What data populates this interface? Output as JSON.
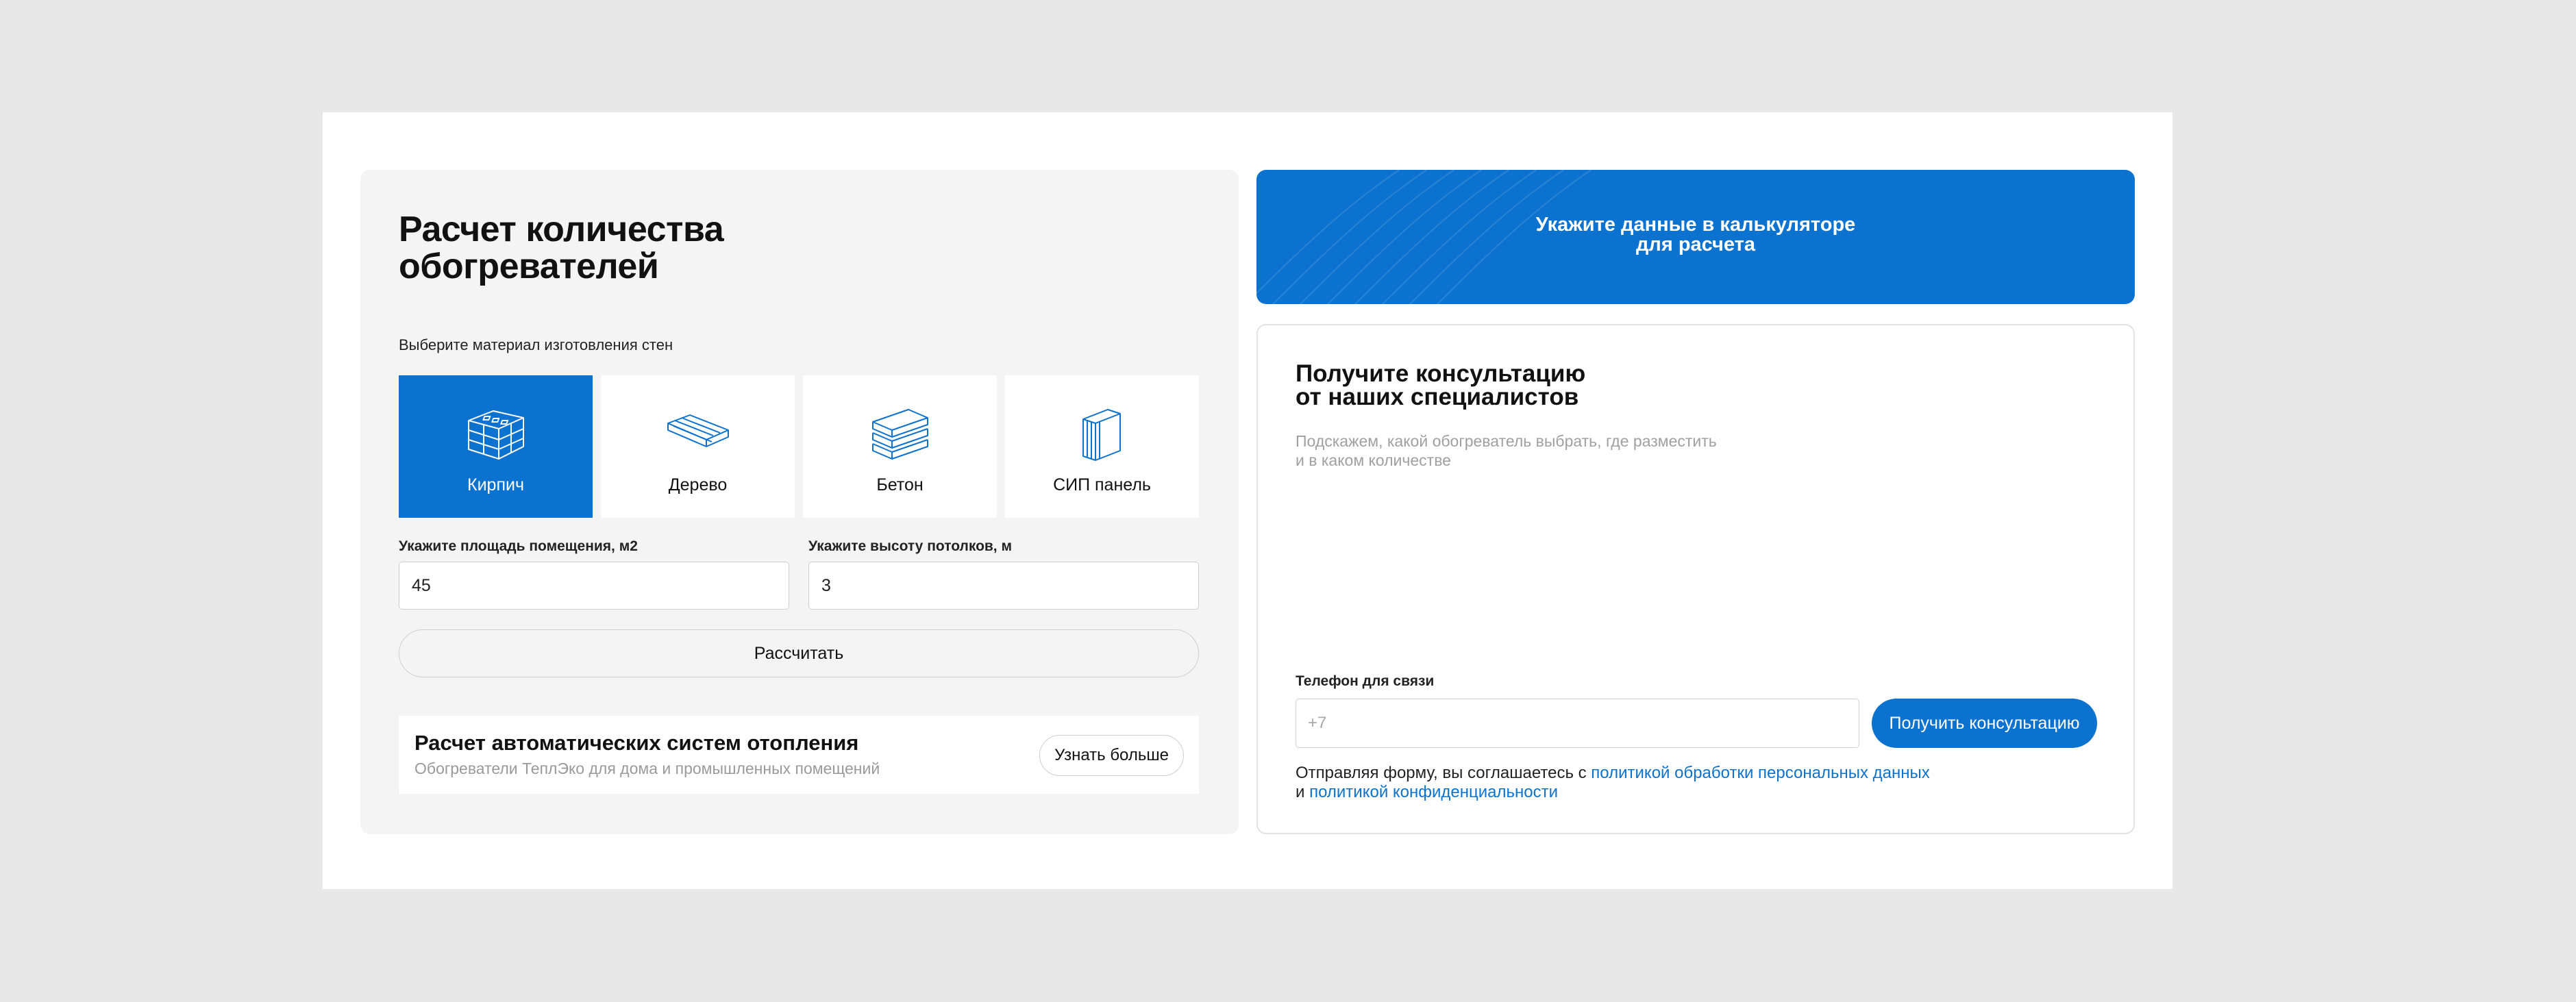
{
  "calculator": {
    "title_line1": "Расчет количества",
    "title_line2": "обогревателей",
    "material_label": "Выберите материал изготовления стен",
    "materials": [
      {
        "label": "Кирпич",
        "icon": "brick-icon",
        "selected": true
      },
      {
        "label": "Дерево",
        "icon": "wood-icon",
        "selected": false
      },
      {
        "label": "Бетон",
        "icon": "concrete-icon",
        "selected": false
      },
      {
        "label": "СИП панель",
        "icon": "sip-panel-icon",
        "selected": false
      }
    ],
    "area_label": "Укажите площадь помещения, м2",
    "area_value": "45",
    "height_label": "Укажите высоту потолков, м",
    "height_value": "3",
    "calculate_button": "Рассчитать"
  },
  "auto_systems": {
    "title": "Расчет автоматических систем отопления",
    "subtitle": "Обогреватели ТеплЭко для дома и промышленных помещений",
    "button": "Узнать больше"
  },
  "result_banner": {
    "line1": "Укажите данные в калькуляторе",
    "line2": "для расчета"
  },
  "consultation": {
    "title_line1": "Получите консультацию",
    "title_line2": "от наших специалистов",
    "subtitle_line1": "Подскажем, какой обогреватель выбрать, где разместить",
    "subtitle_line2": "и в каком количестве",
    "phone_label": "Телефон для связи",
    "phone_placeholder": "+7",
    "submit_button": "Получить консультацию",
    "agree_prefix": "Отправляя форму, вы соглашаетесь с",
    "agree_link1": "политикой обработки персональных данных",
    "agree_and": "и",
    "agree_link2": "политикой конфиденциальности"
  },
  "colors": {
    "accent": "#0b72d0",
    "background": "#e8e8e8",
    "panel": "#f4f4f4"
  }
}
